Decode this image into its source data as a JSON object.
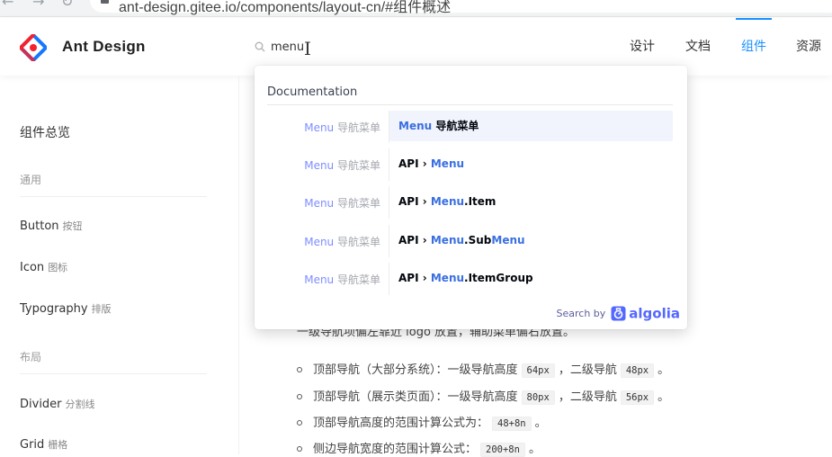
{
  "browser": {
    "url": "ant-design.gitee.io/components/layout-cn/#组件概述"
  },
  "header": {
    "brand": "Ant Design",
    "search_value": "menu",
    "nav": [
      {
        "label": "设计"
      },
      {
        "label": "文档"
      },
      {
        "label": "组件",
        "active": true
      },
      {
        "label": "资源"
      }
    ]
  },
  "sidebar": {
    "title": "组件总览",
    "groups": [
      {
        "label": "通用"
      },
      {
        "label": "布局"
      }
    ],
    "items": [
      {
        "label": "Button",
        "sub": "按钮"
      },
      {
        "label": "Icon",
        "sub": "图标"
      },
      {
        "label": "Typography",
        "sub": "排版"
      },
      {
        "label": "Divider",
        "sub": "分割线"
      },
      {
        "label": "Grid",
        "sub": "栅格"
      }
    ]
  },
  "content": {
    "intro": "一级导航项偏左靠近 logo 放置，辅助菜单偏右放置。",
    "bullets": [
      {
        "text1": "顶部导航（大部分系统）：一级导航高度",
        "code1": "64px",
        "text2": "，二级导航",
        "code2": "48px",
        "text3": "。"
      },
      {
        "text1": "顶部导航（展示类页面）：一级导航高度",
        "code1": "80px",
        "text2": "，二级导航",
        "code2": "56px",
        "text3": "。"
      },
      {
        "text1": "顶部导航高度的范围计算公式为：",
        "code1": "48+8n",
        "text3": "。"
      },
      {
        "text1": "侧边导航宽度的范围计算公式：",
        "code1": "200+8n",
        "text3": "。"
      }
    ]
  },
  "dropdown": {
    "heading": "Documentation",
    "rows": [
      {
        "lvl0_hl": "Menu",
        "lvl0_rest": " 导航菜单",
        "prefix": "",
        "parts": [
          {
            "hl": "Menu"
          },
          {
            "t": " 导航菜单"
          }
        ],
        "active": true
      },
      {
        "lvl0_hl": "Menu",
        "lvl0_rest": " 导航菜单",
        "parts": [
          {
            "t": "API › "
          },
          {
            "hl": "Menu"
          }
        ]
      },
      {
        "lvl0_hl": "Menu",
        "lvl0_rest": " 导航菜单",
        "parts": [
          {
            "t": "API › "
          },
          {
            "hl": "Menu"
          },
          {
            "t": ".Item"
          }
        ]
      },
      {
        "lvl0_hl": "Menu",
        "lvl0_rest": " 导航菜单",
        "parts": [
          {
            "t": "API › "
          },
          {
            "hl": "Menu"
          },
          {
            "t": ".Sub"
          },
          {
            "hl": "Menu"
          }
        ]
      },
      {
        "lvl0_hl": "Menu",
        "lvl0_rest": " 导航菜单",
        "parts": [
          {
            "t": "API › "
          },
          {
            "hl": "Menu"
          },
          {
            "t": ".ItemGroup"
          }
        ]
      }
    ],
    "footer_by": "Search by",
    "footer_brand": "algolia"
  },
  "colors": {
    "primary": "#1890ff",
    "algolia": "#5468ff",
    "logo_red": "#f5222d",
    "logo_blue": "#1677ff"
  }
}
